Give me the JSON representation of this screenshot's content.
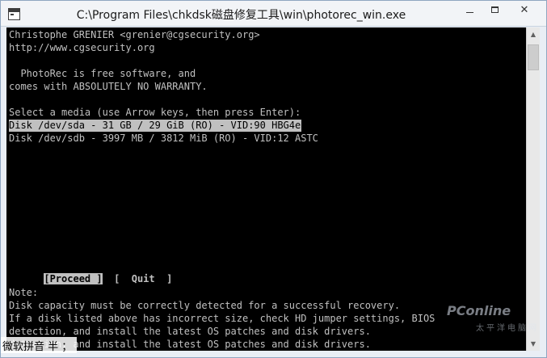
{
  "window": {
    "title": "C:\\Program Files\\chkdsk磁盘修复工具\\win\\photorec_win.exe",
    "controls": {
      "minimize": "minimize",
      "maximize": "maximize",
      "close": "✕"
    }
  },
  "console": {
    "header": [
      "Christophe GRENIER <grenier@cgsecurity.org>",
      "http://www.cgsecurity.org",
      "",
      "  PhotoRec is free software, and",
      "comes with ABSOLUTELY NO WARRANTY.",
      "",
      "Select a media (use Arrow keys, then press Enter):"
    ],
    "disks": [
      {
        "label": "Disk /dev/sda - 31 GB / 29 GiB (RO) - VID:90 HBG4e",
        "selected": true
      },
      {
        "label": "Disk /dev/sdb - 3997 MB / 3812 MiB (RO) - VID:12 ASTC",
        "selected": false
      }
    ],
    "menu": {
      "proceed": "[Proceed ]",
      "quit": "[  Quit  ]"
    },
    "note": [
      "Note:",
      "Disk capacity must be correctly detected for a successful recovery.",
      "If a disk listed above has incorrect size, check HD jumper settings, BIOS",
      "detection, and install the latest OS patches and disk drivers.",
      "detection, and install the latest OS patches and disk drivers."
    ]
  },
  "watermark": {
    "logo": "PConline",
    "sub": "太平洋电脑网"
  },
  "ime": {
    "text": "微软拼音 半 ；"
  },
  "colors": {
    "console_bg": "#000000",
    "console_fg": "#c0c0c0",
    "highlight_bg": "#c0c0c0"
  }
}
